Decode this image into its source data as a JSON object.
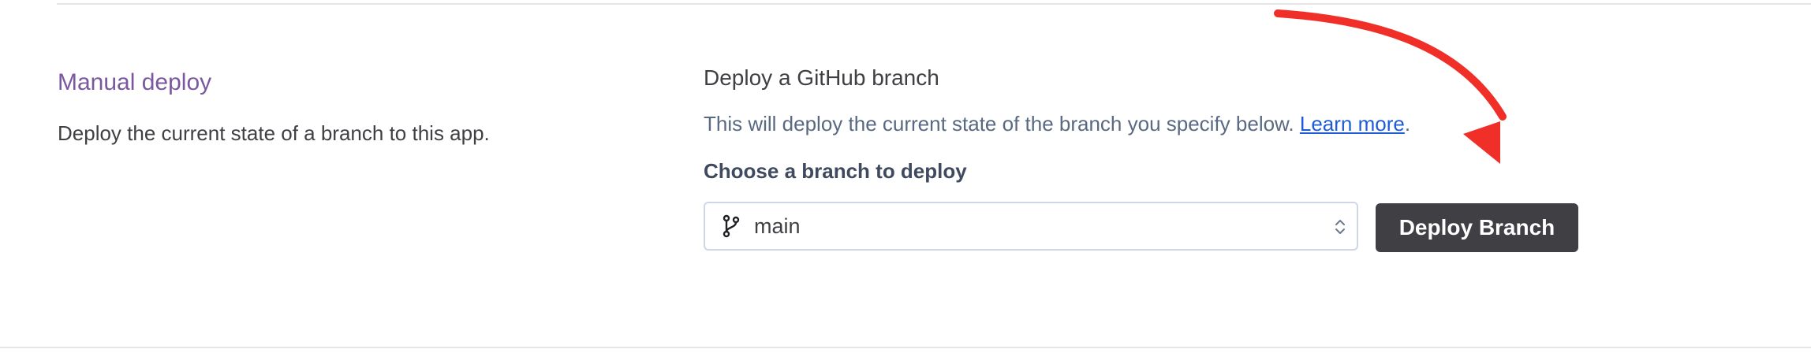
{
  "manual_deploy": {
    "title": "Manual deploy",
    "description": "Deploy the current state of a branch to this app."
  },
  "github_deploy": {
    "title": "Deploy a GitHub branch",
    "description": "This will deploy the current state of the branch you specify below.",
    "learn_more_label": "Learn more",
    "trailing_period": ".",
    "branch_field_label": "Choose a branch to deploy",
    "selected_branch": "main",
    "deploy_button_label": "Deploy Branch"
  },
  "icons": {
    "branch": "git-branch-icon",
    "caret": "select-caret-icon",
    "annotation": "red-curved-arrow"
  },
  "colors": {
    "section_title": "#79589f",
    "link": "#1f5bd6",
    "button_bg": "#3f3f44",
    "annotation_arrow": "#f03028"
  }
}
